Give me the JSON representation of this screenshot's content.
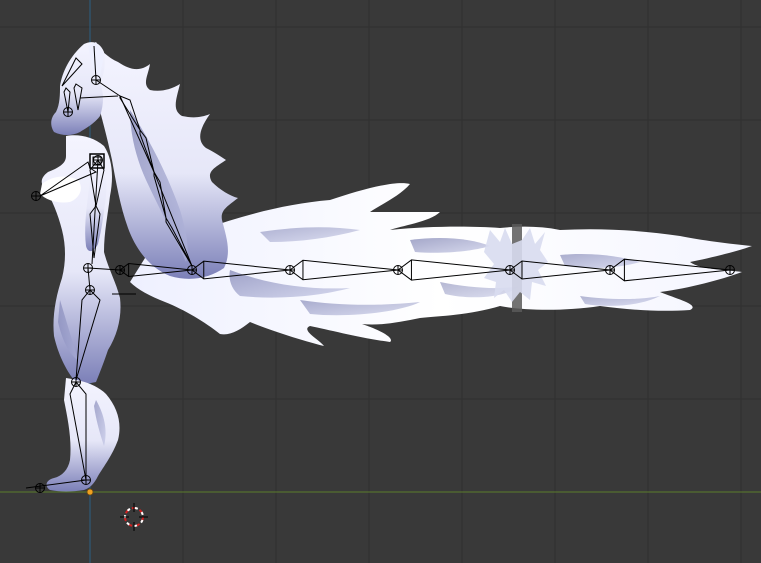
{
  "viewport": {
    "view": "Right Ortho",
    "background_color": "#393939",
    "grid_color": "#2f2f2f",
    "axis_x_color": "#5c7d2c",
    "axis_z_color": "#2c5f83",
    "mesh_light_color": "#f4f4ff",
    "mesh_shade_color": "#4a4f8a",
    "armature_color": "#000000",
    "origin_color": "#f0a020",
    "cursor_ring_color": "#d22020",
    "cursor_cross_color": "#000000"
  },
  "scene": {
    "model": "furry-character-mesh",
    "armature": "character-armature",
    "tail_bones": 6,
    "spine_bones": 5,
    "leg_bones": 3
  }
}
